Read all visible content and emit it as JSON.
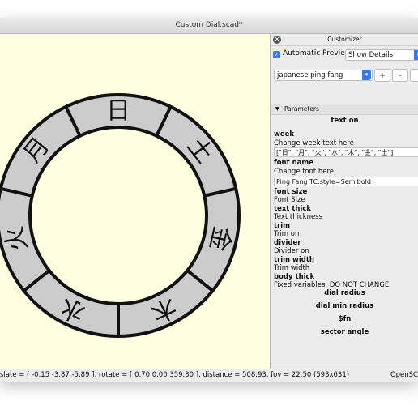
{
  "window": {
    "title": "Custom Dial.scad*"
  },
  "dial": {
    "labels": [
      "日",
      "土",
      "金",
      "木",
      "水",
      "火",
      "月"
    ],
    "colors": {
      "viewport_bg": "#fffee0",
      "ring_fill": "#cccccc",
      "stroke": "#111111"
    }
  },
  "status": {
    "text": "slate = [ -0.15 -3.87 -5.89 ], rotate = [ 0.70 0.00 359.30 ], distance = 508.93, fov = 22.50 (593x631)",
    "brand": "OpenSC"
  },
  "customizer": {
    "title": "Customizer",
    "auto_preview": {
      "label": "Automatic Preview",
      "checked": true
    },
    "details_select": "Show Details",
    "preset_select": "japanese ping fang",
    "plus_label": "+",
    "minus_label": "-",
    "extra_btn": "",
    "parameters_label": "Parameters",
    "tab_heading": "text on",
    "week": {
      "name": "week",
      "desc": "Change week text here",
      "value": "[\"日\", \"月\", \"火\", \"水\", \"木\", \"金\", \"土\"]"
    },
    "font_name": {
      "name": "font name",
      "desc": "Change font here",
      "value": "Ping Fang TC:style=Semibold"
    },
    "font_size": {
      "name": "font size",
      "desc": "Font Size"
    },
    "text_thick": {
      "name": "text thick",
      "desc": "Text thickness"
    },
    "trim": {
      "name": "trim",
      "desc": "Trim on"
    },
    "divider": {
      "name": "divider",
      "desc": "Divider on"
    },
    "trim_width": {
      "name": "trim width",
      "desc": "Trim width"
    },
    "body_thick": {
      "name": "body thick",
      "desc": "Fixed variables.  DO NOT CHANGE"
    },
    "sections": [
      "dial radius",
      "dial min radius",
      "$fn",
      "sector angle"
    ]
  }
}
